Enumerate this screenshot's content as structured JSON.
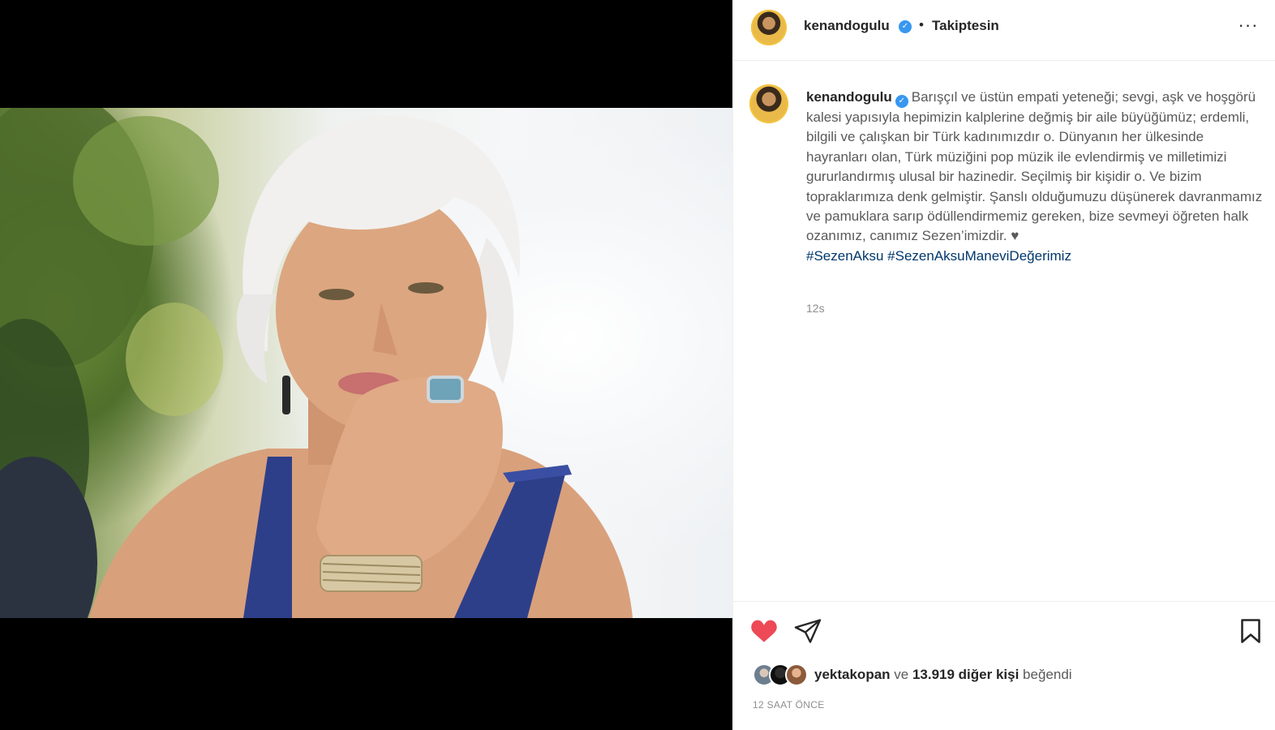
{
  "post": {
    "username": "kenandogulu",
    "separator": "•",
    "follow_status": "Takiptesin",
    "more_icon": "more-horizontal-icon",
    "more_glyph": "···",
    "verified_glyph": "✓",
    "media": {
      "description_icon": "photo"
    }
  },
  "caption": {
    "username": "kenandogulu",
    "text": "Barışçıl ve üstün empati yeteneği; sevgi, aşk ve hoşgörü kalesi yapısıyla hepimizin kalplerine değmiş bir aile büyüğümüz; erdemli, bilgili ve çalışkan bir Türk kadınımızdır o. Dünyanın her ülkesinde hayranları olan, Türk müziğini pop müzik ile evlendirmiş ve milletimizi gururlandırmış ulusal bir hazinedir. Seçilmiş bir kişidir o. Ve bizim topraklarımıza denk gelmiştir. Şanslı olduğumuzu düşünerek davranmamız ve pamuklara sarıp ödüllendirmemiz gereken, bize sevmeyi öğreten halk ozanımız, canımız Sezen’imizdir. ♥",
    "hashtags": "#SezenAksu #SezenAksuManeviDeğerimiz",
    "time_ago": "12s"
  },
  "actions": {
    "like_icon": "heart-filled-icon",
    "share_icon": "paper-plane-icon",
    "save_icon": "bookmark-icon",
    "liked": true,
    "like_color": "#ed4956"
  },
  "likes": {
    "first_user": "yektakopan",
    "connector": " ve ",
    "others": "13.919 diğer kişi",
    "suffix": " beğendi"
  },
  "date": "12 SAAT ÖNCE",
  "colors": {
    "accent_blue": "#3897f0",
    "hashtag": "#00376b",
    "secondary_text": "#8e8e8e"
  }
}
